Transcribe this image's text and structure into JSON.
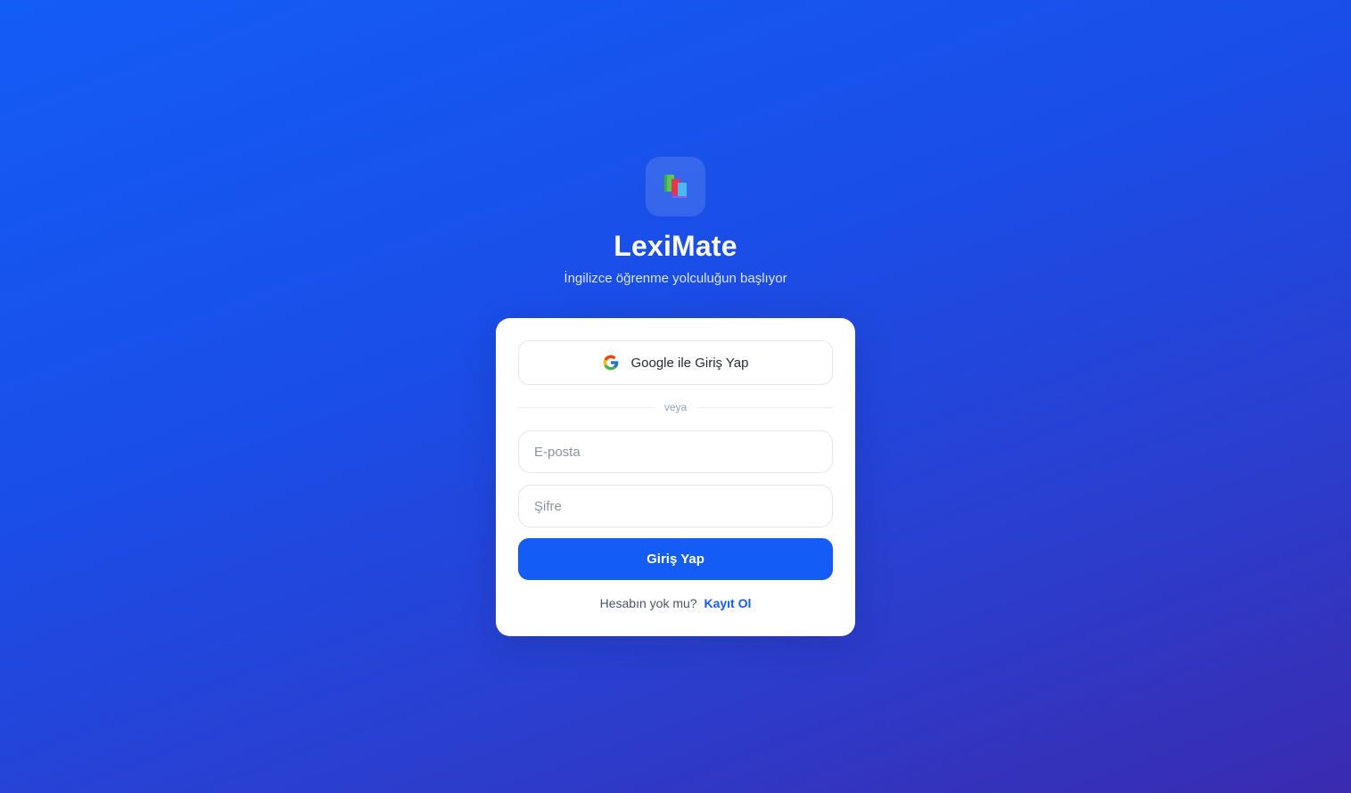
{
  "app": {
    "title": "LexiMate",
    "subtitle": "İngilizce öğrenme yolculuğun başlıyor",
    "logo_icon": "books-icon"
  },
  "login": {
    "google_label": "Google ile Giriş Yap",
    "divider_text": "veya",
    "email_placeholder": "E-posta",
    "email_value": "",
    "password_placeholder": "Şifre",
    "password_value": "",
    "submit_label": "Giriş Yap",
    "signup_prompt": "Hesabın yok mu?",
    "signup_link": "Kayıt Ol"
  },
  "colors": {
    "primary": "#145cf6",
    "background_start": "#145cf6",
    "background_end": "#3a2bb0",
    "card": "#ffffff"
  }
}
